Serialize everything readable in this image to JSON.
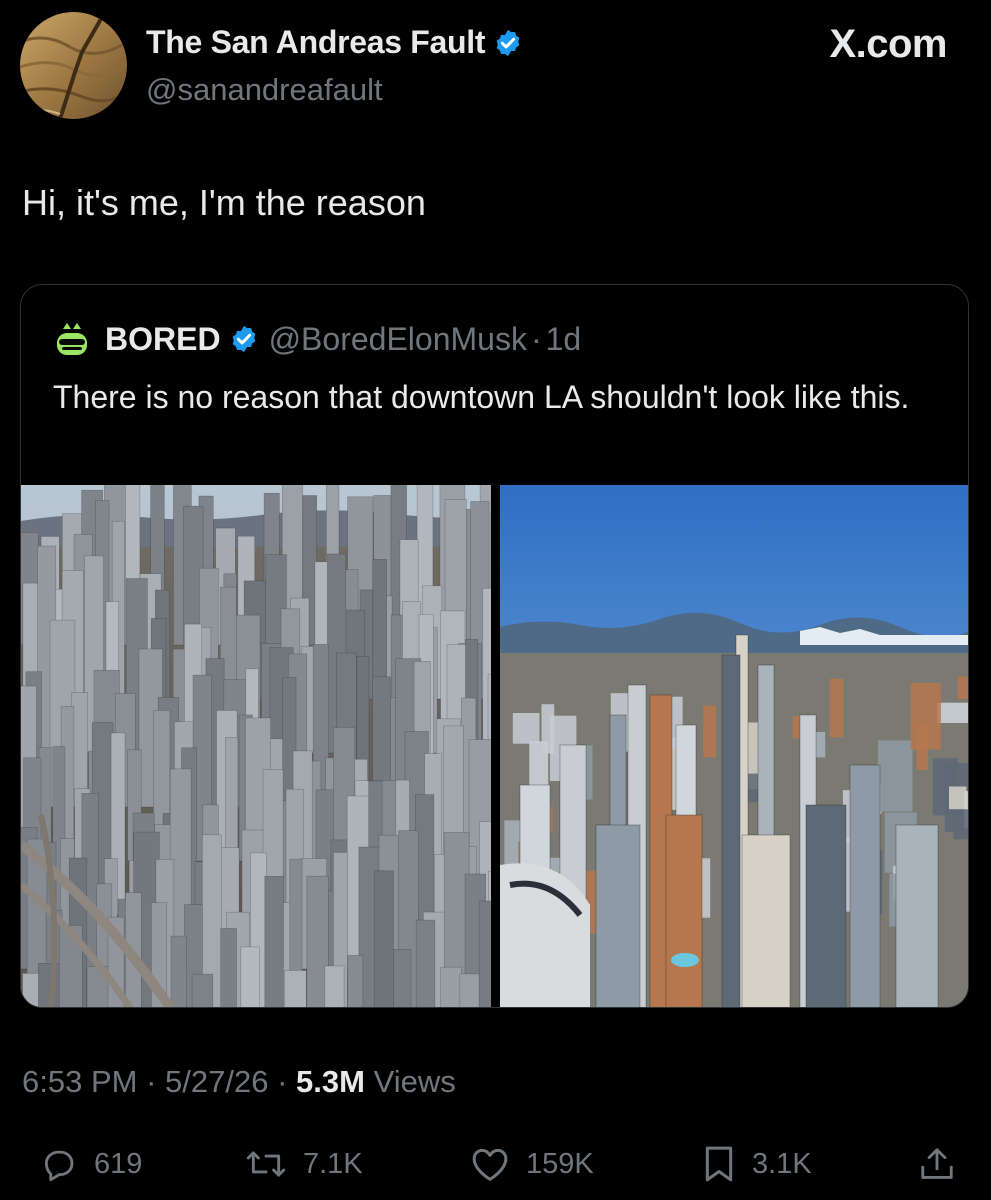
{
  "author": {
    "display_name": "The San Andreas Fault",
    "handle": "@sanandreafault",
    "verified": true
  },
  "watermark": "X.com",
  "tweet_text": "Hi, it's me, I'm the reason",
  "quoted": {
    "display_name": "BORED",
    "handle": "@BoredElonMusk",
    "separator": "·",
    "time": "1d",
    "text": "There is no reason that downtown LA shouldn't look like this."
  },
  "meta": {
    "time": "6:53 PM",
    "sep1": "·",
    "date": "5/27/26",
    "sep2": "·",
    "views_count": "5.3M",
    "views_label": "Views"
  },
  "actions": {
    "replies": "619",
    "reposts": "7.1K",
    "likes": "159K",
    "bookmarks": "3.1K"
  },
  "colors": {
    "background": "#000000",
    "text": "#e7e9ea",
    "secondary": "#71767b",
    "verified": "#1d9bf0"
  },
  "icons": [
    "verified-badge-icon",
    "reply-icon",
    "repost-icon",
    "like-icon",
    "bookmark-icon",
    "share-icon"
  ]
}
